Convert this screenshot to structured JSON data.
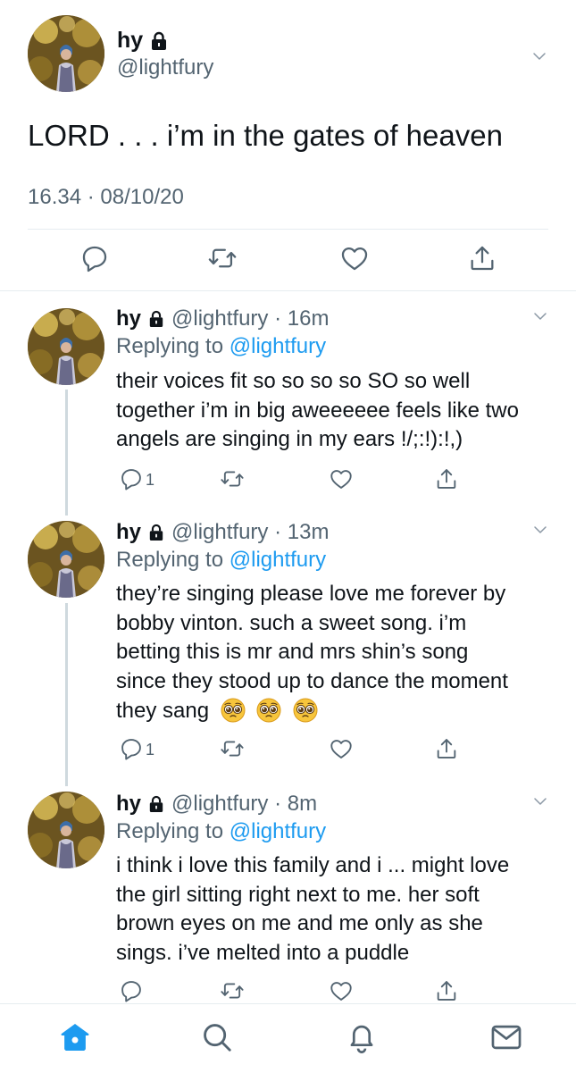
{
  "colors": {
    "accent": "#1d9bf0",
    "secondary_text": "#536471",
    "divider": "#e6ecf0",
    "thread_line": "#cfd9de"
  },
  "main_tweet": {
    "name": "hy",
    "handle": "@lightfury",
    "text": "LORD . . . i’m in the gates of heaven",
    "timestamp": "16.34 · 08/10/20",
    "icons": [
      "chevron-down-icon",
      "reply-icon",
      "retweet-icon",
      "like-icon",
      "share-icon",
      "lock-icon"
    ]
  },
  "replies": [
    {
      "name": "hy",
      "handle_time": "@lightfury · 16m",
      "replying_prefix": "Replying to",
      "replying_handle": "@lightfury",
      "lines": [
        "their voices fit so so so so SO so well",
        "together i’m in big aweeeeee feels like two",
        "angels are singing in my ears !/;:!):!,)"
      ],
      "reply_count": "1"
    },
    {
      "name": "hy",
      "handle_time": "@lightfury · 13m",
      "replying_prefix": "Replying to",
      "replying_handle": "@lightfury",
      "lines": [
        "they’re singing please love me forever by",
        "bobby vinton. such a sweet song. i’m",
        "betting this is mr and mrs shin’s song",
        "since they stood up to dance the moment",
        "they sang"
      ],
      "emojis": [
        "pleading-face-emoji",
        "pleading-face-emoji",
        "pleading-face-emoji"
      ],
      "reply_count": "1"
    },
    {
      "name": "hy",
      "handle_time": "@lightfury · 8m",
      "replying_prefix": "Replying to",
      "replying_handle": "@lightfury",
      "lines": [
        "i think i love this family and i ... might love",
        "the girl sitting right next to me. her soft",
        "brown eyes on me and me only as she",
        "sings. i’ve melted into a puddle"
      ],
      "reply_count": ""
    }
  ],
  "bottom_nav": [
    "home-icon",
    "search-icon",
    "notifications-icon",
    "messages-icon"
  ]
}
